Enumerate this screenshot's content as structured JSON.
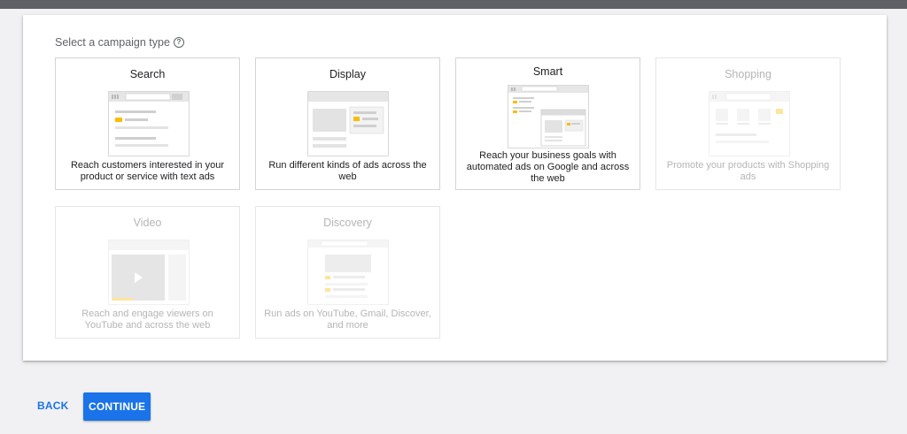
{
  "heading": {
    "label": "Select a campaign type",
    "help_icon": "?"
  },
  "campaign_types": [
    {
      "id": "search",
      "title": "Search",
      "description": "Reach customers interested in your product or service with text ads",
      "enabled": true
    },
    {
      "id": "display",
      "title": "Display",
      "description": "Run different kinds of ads across the web",
      "enabled": true
    },
    {
      "id": "smart",
      "title": "Smart",
      "description": "Reach your business goals with automated ads on Google and across the web",
      "enabled": true
    },
    {
      "id": "shopping",
      "title": "Shopping",
      "description": "Promote your products with Shopping ads",
      "enabled": false
    },
    {
      "id": "video",
      "title": "Video",
      "description": "Reach and engage viewers on YouTube and across the web",
      "enabled": false
    },
    {
      "id": "discovery",
      "title": "Discovery",
      "description": "Run ads on YouTube, Gmail, Discover, and more",
      "enabled": false
    }
  ],
  "actions": {
    "back_label": "BACK",
    "continue_label": "CONTINUE"
  },
  "colors": {
    "accent": "#1a73e8",
    "highlight": "#fbbc04",
    "topbar": "#5f6166"
  }
}
